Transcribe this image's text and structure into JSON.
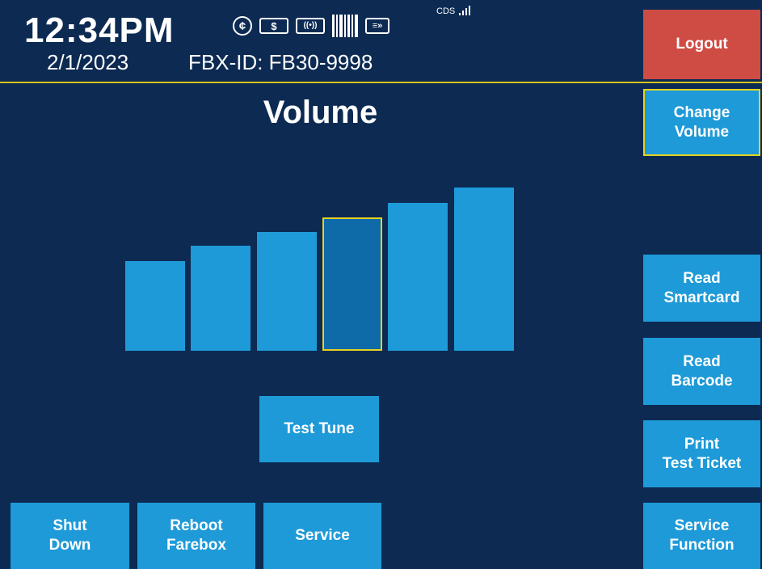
{
  "header": {
    "time": "12:34PM",
    "date": "2/1/2023",
    "fbx_id": "FBX-ID: FB30-9998",
    "cds_label": "CDS",
    "icons": [
      "coin-icon",
      "bill-icon",
      "contactless-icon",
      "barcode-icon",
      "card-reader-icon",
      "signal-icon"
    ],
    "coin_glyph": "¢",
    "bill_glyph": "$",
    "contactless_glyph": "((•))",
    "card_glyph": "≡»"
  },
  "page": {
    "title": "Volume"
  },
  "volume": {
    "levels": 6,
    "selected_level": 4
  },
  "buttons": {
    "logout": "Logout",
    "change_volume": "Change\nVolume",
    "read_smartcard": "Read\nSmartcard",
    "read_barcode": "Read\nBarcode",
    "print_test_ticket": "Print\nTest Ticket",
    "service_function": "Service\nFunction",
    "test_tune": "Test Tune",
    "shut_down": "Shut\nDown",
    "reboot_farebox": "Reboot\nFarebox",
    "service": "Service"
  },
  "colors": {
    "background": "#0c2a52",
    "button": "#1e9ad8",
    "logout": "#cf4c45",
    "highlight": "#e8d21f",
    "selected_bar": "#0f6aa8"
  }
}
